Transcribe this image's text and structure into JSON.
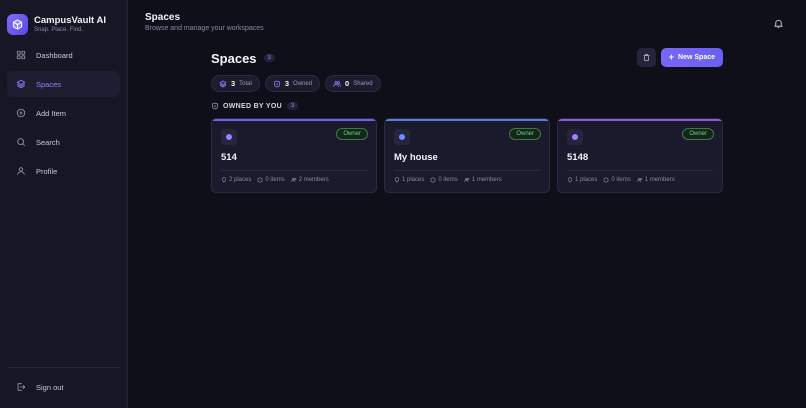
{
  "brand": {
    "title": "CampusVault AI",
    "subtitle": "Snap. Place. Find."
  },
  "sidebar": {
    "items": [
      {
        "label": "Dashboard",
        "icon": "grid-icon",
        "active": false
      },
      {
        "label": "Spaces",
        "icon": "layers-icon",
        "active": true
      },
      {
        "label": "Add Item",
        "icon": "plus-circle-icon",
        "active": false
      },
      {
        "label": "Search",
        "icon": "search-icon",
        "active": false
      },
      {
        "label": "Profile",
        "icon": "user-icon",
        "active": false
      }
    ],
    "signout_label": "Sign out"
  },
  "topbar": {
    "title": "Spaces",
    "subtitle": "Browse and manage your workspaces"
  },
  "spaces": {
    "title": "Spaces",
    "count": "3",
    "new_button_label": "New Space",
    "stats": [
      {
        "value": "3",
        "label": "Total"
      },
      {
        "value": "3",
        "label": "Owned"
      },
      {
        "value": "0",
        "label": "Shared"
      }
    ],
    "section": {
      "label": "OWNED BY YOU",
      "count": "3"
    },
    "cards": [
      {
        "name": "514",
        "badge": "Owner",
        "places": "2 places",
        "items": "0 items",
        "members": "2 members",
        "accent": "#6b63e8"
      },
      {
        "name": "My house",
        "badge": "Owner",
        "places": "1 places",
        "items": "0 items",
        "members": "1 members",
        "accent": "#5c7be0"
      },
      {
        "name": "5148",
        "badge": "Owner",
        "places": "1 places",
        "items": "0 items",
        "members": "1 members",
        "accent": "#8e5ce0"
      }
    ]
  },
  "colors": {
    "accent": "#7867f6",
    "owner_green": "#6ed186",
    "background": "#0f0f1a",
    "sidebar": "#161625"
  }
}
